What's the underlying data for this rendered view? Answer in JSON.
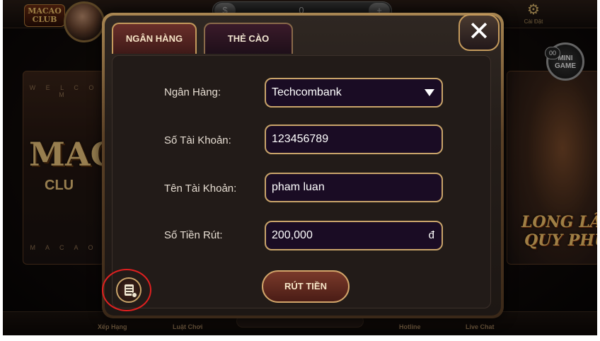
{
  "top_bar": {
    "logo_text": "MACAO CLUB",
    "coin_minus": "$",
    "coin_value": "0",
    "coin_plus": "+",
    "settings_label": "Cài Đặt"
  },
  "background": {
    "left_card": {
      "welcome": "W E L C O M",
      "big_text": "MAC",
      "small_text": "CLU",
      "bottom": "M A C A O"
    },
    "right_card": {
      "line1": "LONG LÂ",
      "line2": "QUY PHỤ"
    },
    "minigame": {
      "count": "00",
      "label": "MINI GAME"
    }
  },
  "bottom_bar": {
    "items": [
      "Xếp Hạng",
      "Luật Chơi",
      "Hotline",
      "Live Chat"
    ]
  },
  "modal": {
    "tabs": [
      {
        "label": "NGÂN HÀNG",
        "active": true
      },
      {
        "label": "THẺ CÀO",
        "active": false
      }
    ],
    "close_label": "✕",
    "form": {
      "bank": {
        "label": "Ngân Hàng:",
        "value": "Techcombank"
      },
      "account_number": {
        "label": "Số Tài Khoản:",
        "value": "123456789"
      },
      "account_name": {
        "label": "Tên Tài Khoản:",
        "value": "pham luan"
      },
      "amount": {
        "label": "Số Tiền Rút:",
        "value": "200,000",
        "suffix": "đ"
      }
    },
    "withdraw_button": "RÚT TIỀN",
    "history_icon": "document-history-icon"
  },
  "colors": {
    "accent_gold": "#c9a46a",
    "field_bg": "#1a0c24",
    "highlight_ring": "#e02020"
  }
}
